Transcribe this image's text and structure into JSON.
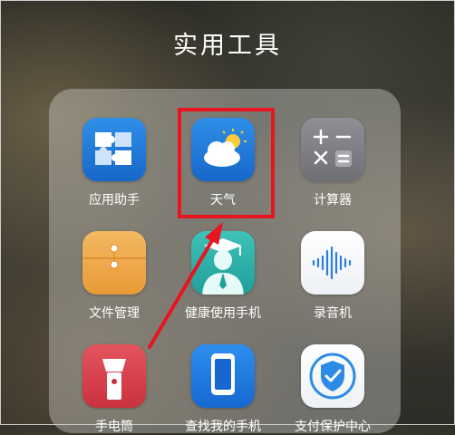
{
  "folder": {
    "title": "实用工具"
  },
  "apps": [
    {
      "label": "应用助手",
      "icon": "puzzle-icon"
    },
    {
      "label": "天气",
      "icon": "weather-cloud-sun-icon"
    },
    {
      "label": "计算器",
      "icon": "calculator-icon"
    },
    {
      "label": "文件管理",
      "icon": "folder-envelope-icon"
    },
    {
      "label": "健康使用手机",
      "icon": "health-graduate-icon"
    },
    {
      "label": "录音机",
      "icon": "audio-wave-icon"
    },
    {
      "label": "手电筒",
      "icon": "flashlight-icon"
    },
    {
      "label": "查找我的手机",
      "icon": "find-phone-icon"
    },
    {
      "label": "支付保护中心",
      "icon": "shield-check-icon"
    }
  ],
  "annotation": {
    "highlight_color": "#e8141f",
    "target": "天气"
  }
}
